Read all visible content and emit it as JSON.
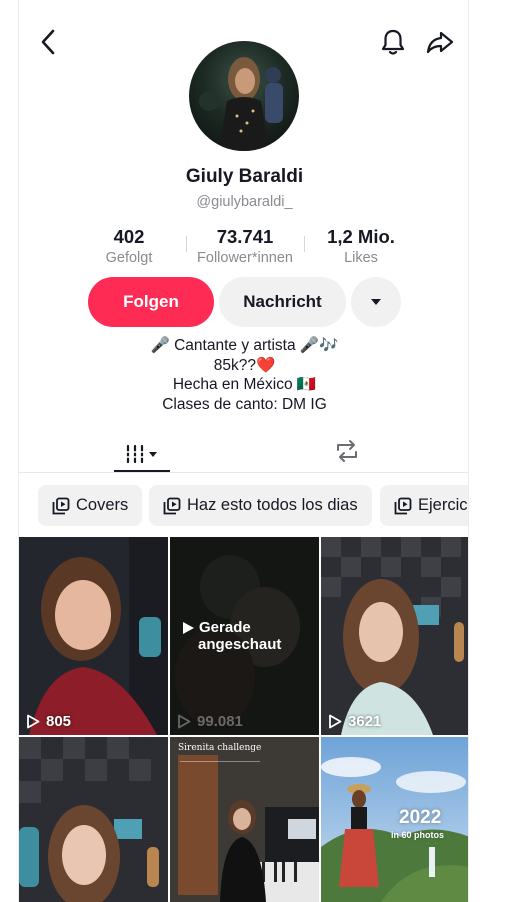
{
  "header": {
    "back_icon": "chevron-left-icon",
    "bell_icon": "bell-icon",
    "share_icon": "share-arrow-icon"
  },
  "profile": {
    "display_name": "Giuly Baraldi",
    "username": "@giulybaraldi_"
  },
  "stats": [
    {
      "value": "402",
      "label": "Gefolgt"
    },
    {
      "value": "73.741",
      "label": "Follower*innen"
    },
    {
      "value": "1,2 Mio.",
      "label": "Likes"
    }
  ],
  "actions": {
    "follow_label": "Folgen",
    "message_label": "Nachricht",
    "more_icon": "caret-down-icon"
  },
  "bio": {
    "line1": "🎤 Cantante y artista 🎤🎶",
    "line2": "85k??❤️",
    "line3": "Hecha en México 🇲🇽",
    "line4": "Clases de canto: DM IG"
  },
  "tabs": {
    "videos_icon": "grid-bars-icon",
    "reposts_icon": "repost-icon"
  },
  "playlists": [
    {
      "label": "Covers"
    },
    {
      "label": "Haz esto todos los dias"
    },
    {
      "label": "Ejercici"
    }
  ],
  "videos": [
    {
      "views": "805"
    },
    {
      "views": "99.081",
      "overlay": "Gerade angeschaut",
      "overlay_line1": "Gerade",
      "overlay_line2": "angeschaut"
    },
    {
      "views": "3621"
    },
    {
      "views": ""
    },
    {
      "views": "",
      "caption_top": "Sirenita challenge"
    },
    {
      "views": "",
      "title": "2022",
      "subtitle": "in 60 photos"
    }
  ],
  "colors": {
    "accent": "#fe2c55",
    "text": "#161823",
    "secondary_text": "#8a8b91",
    "button_bg": "#f1f1f2"
  }
}
